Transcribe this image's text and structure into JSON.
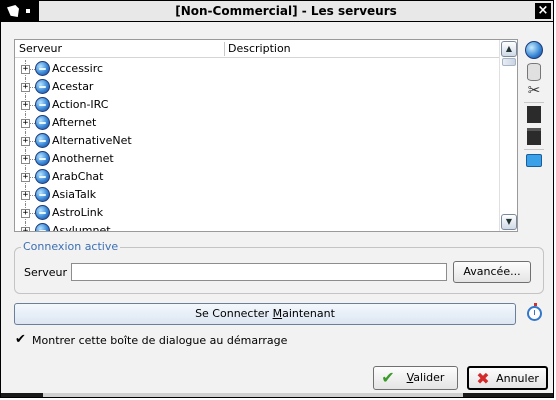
{
  "window": {
    "title": "[Non-Commercial] - Les serveurs",
    "close_label": "×"
  },
  "list": {
    "columns": [
      "Serveur",
      "Description"
    ],
    "rows": [
      {
        "name": "Accessirc"
      },
      {
        "name": "Acestar"
      },
      {
        "name": "Action-IRC"
      },
      {
        "name": "Afternet"
      },
      {
        "name": "AlternativeNet"
      },
      {
        "name": "Anothernet"
      },
      {
        "name": "ArabChat"
      },
      {
        "name": "AsiaTalk"
      },
      {
        "name": "AstroLink"
      },
      {
        "name": "Asylumnet"
      }
    ],
    "expander": "+"
  },
  "toolbar_icons": [
    "globe-icon",
    "database-icon",
    "scissors-icon",
    "document-icon",
    "clipboard-icon",
    "folder-icon"
  ],
  "connexion": {
    "group_title": "Connexion active",
    "serveur_label": "Serveur :",
    "serveur_value": "",
    "avancee_label": "Avancée..."
  },
  "connect_button": {
    "prefix": "Se Connecter ",
    "mnemonic": "M",
    "suffix": "aintenant"
  },
  "startup_checkbox": {
    "checked": true,
    "label": "Montrer cette boîte de dialogue au démarrage"
  },
  "footer": {
    "valider": {
      "mnemonic": "V",
      "rest": "alider"
    },
    "annuler": {
      "label": "Annuler"
    }
  }
}
